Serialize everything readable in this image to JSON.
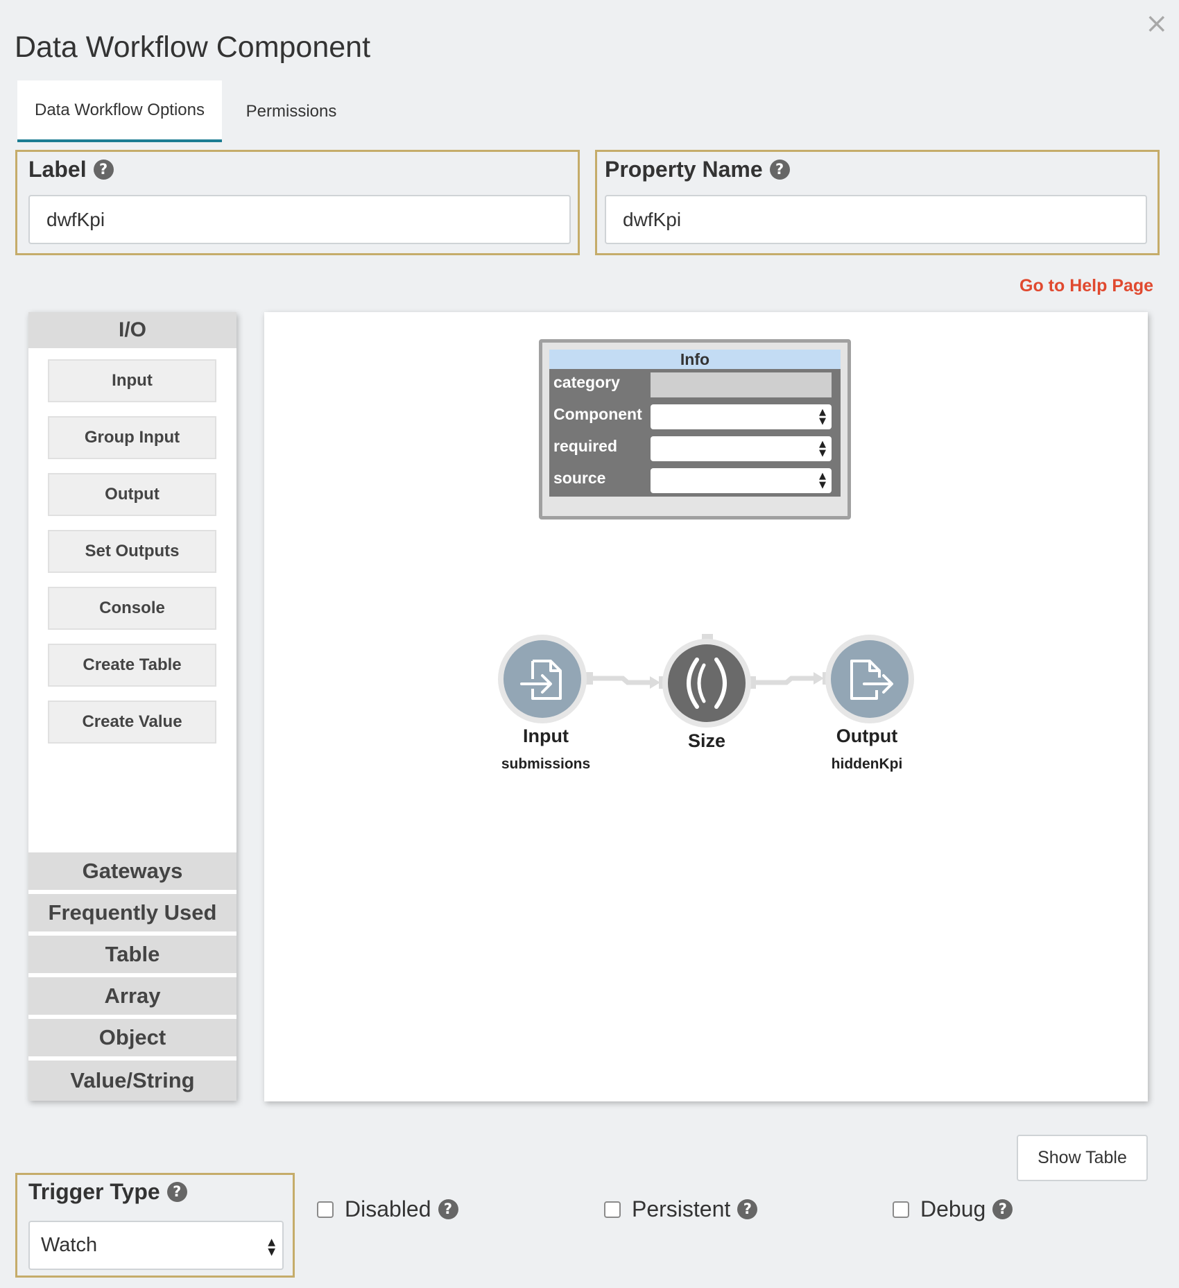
{
  "dialog": {
    "title": "Data Workflow Component",
    "close_icon": "close-icon"
  },
  "tabs": [
    {
      "label": "Data Workflow Options",
      "active": true
    },
    {
      "label": "Permissions",
      "active": false
    }
  ],
  "label_field": {
    "label": "Label",
    "value": "dwfKpi",
    "help_icon": "?"
  },
  "property_field": {
    "label": "Property Name",
    "value": "dwfKpi",
    "help_icon": "?"
  },
  "help_link": "Go to Help Page",
  "palette": {
    "active_section": "I/O",
    "items": [
      "Input",
      "Group Input",
      "Output",
      "Set Outputs",
      "Console",
      "Create Table",
      "Create Value"
    ],
    "sections": [
      "Gateways",
      "Frequently Used",
      "Table",
      "Array",
      "Object",
      "Value/String"
    ]
  },
  "info_panel": {
    "title": "Info",
    "rows": [
      {
        "key": "category",
        "value": ""
      },
      {
        "key": "Component",
        "value": ""
      },
      {
        "key": "required",
        "value": ""
      },
      {
        "key": "source",
        "value": ""
      }
    ]
  },
  "nodes": [
    {
      "label": "Input",
      "sublabel": "submissions",
      "icon": "file-import-icon"
    },
    {
      "label": "Size",
      "sublabel": "",
      "icon": "parentheses-icon"
    },
    {
      "label": "Output",
      "sublabel": "hiddenKpi",
      "icon": "file-export-icon"
    }
  ],
  "show_table_button": "Show Table",
  "trigger_type": {
    "label": "Trigger Type",
    "value": "Watch"
  },
  "checkboxes": [
    {
      "label": "Disabled",
      "checked": false
    },
    {
      "label": "Persistent",
      "checked": false
    },
    {
      "label": "Debug",
      "checked": false
    }
  ],
  "colors": {
    "accent_border": "#c5ac6a",
    "tab_underline": "#1b7c92",
    "help_link": "#e0492f",
    "node_light": "#93a6b5",
    "node_dark": "#6a6a6a",
    "info_header": "#c3dcf4"
  }
}
